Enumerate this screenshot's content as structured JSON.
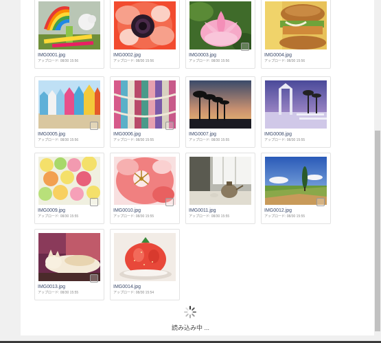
{
  "meta_prefix": "アップロード:",
  "images": [
    {
      "filename": "IMG0001.jpg",
      "uploaded": "08/30 15:56"
    },
    {
      "filename": "IMG0002.jpg",
      "uploaded": "08/30 15:56"
    },
    {
      "filename": "IMG0003.jpg",
      "uploaded": "08/30 15:56"
    },
    {
      "filename": "IMG0004.jpg",
      "uploaded": "08/30 15:56"
    },
    {
      "filename": "IMG0005.jpg",
      "uploaded": "08/30 15:56"
    },
    {
      "filename": "IMG0006.jpg",
      "uploaded": "08/30 15:55"
    },
    {
      "filename": "IMG0007.jpg",
      "uploaded": "08/30 15:55"
    },
    {
      "filename": "IMG0008.jpg",
      "uploaded": "08/30 15:55"
    },
    {
      "filename": "IMG0009.jpg",
      "uploaded": "08/30 15:55"
    },
    {
      "filename": "IMG0010.jpg",
      "uploaded": "08/30 15:55"
    },
    {
      "filename": "IMG0011.jpg",
      "uploaded": "08/30 15:55"
    },
    {
      "filename": "IMG0012.jpg",
      "uploaded": "08/30 15:55"
    },
    {
      "filename": "IMG0013.jpg",
      "uploaded": "08/30 15:55"
    },
    {
      "filename": "IMG0014.jpg",
      "uploaded": "08/30 15:54"
    }
  ],
  "loading": {
    "label": "読み込み中 ...",
    "icon": "spinner-icon"
  },
  "colors": {
    "filename_text": "#3b4a6b",
    "meta_text": "#8a8a8a",
    "card_border": "#e2e2e2"
  }
}
